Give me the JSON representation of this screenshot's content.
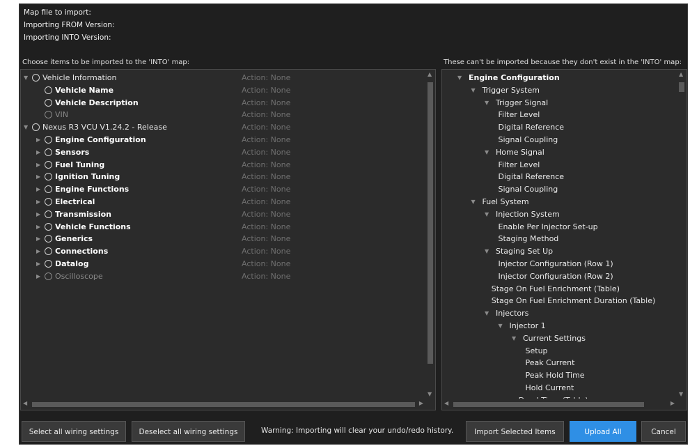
{
  "header": {
    "map_file_label": "Map file to import:",
    "from_label": "Importing FROM Version:",
    "into_label": "Importing INTO Version:"
  },
  "left_panel": {
    "caption": "Choose items to be imported to the 'INTO' map:",
    "items": [
      {
        "label": "Vehicle Information",
        "action": "Action: None",
        "level": 0,
        "arrow": "down",
        "style": "normal"
      },
      {
        "label": "Vehicle Name",
        "action": "Action: None",
        "level": 1,
        "arrow": "none",
        "style": "bold"
      },
      {
        "label": "Vehicle Description",
        "action": "Action: None",
        "level": 1,
        "arrow": "none",
        "style": "bold"
      },
      {
        "label": "VIN",
        "action": "Action: None",
        "level": 1,
        "arrow": "none",
        "style": "dim"
      },
      {
        "label": "Nexus R3 VCU V1.24.2 - Release",
        "action": "Action: None",
        "level": 0,
        "arrow": "down",
        "style": "normal"
      },
      {
        "label": "Engine Configuration",
        "action": "Action: None",
        "level": 1,
        "arrow": "right",
        "style": "bold"
      },
      {
        "label": "Sensors",
        "action": "Action: None",
        "level": 1,
        "arrow": "right",
        "style": "bold"
      },
      {
        "label": "Fuel Tuning",
        "action": "Action: None",
        "level": 1,
        "arrow": "right",
        "style": "bold"
      },
      {
        "label": "Ignition Tuning",
        "action": "Action: None",
        "level": 1,
        "arrow": "right",
        "style": "bold"
      },
      {
        "label": "Engine Functions",
        "action": "Action: None",
        "level": 1,
        "arrow": "right",
        "style": "bold"
      },
      {
        "label": "Electrical",
        "action": "Action: None",
        "level": 1,
        "arrow": "right",
        "style": "bold"
      },
      {
        "label": "Transmission",
        "action": "Action: None",
        "level": 1,
        "arrow": "right",
        "style": "bold"
      },
      {
        "label": "Vehicle Functions",
        "action": "Action: None",
        "level": 1,
        "arrow": "right",
        "style": "bold"
      },
      {
        "label": "Generics",
        "action": "Action: None",
        "level": 1,
        "arrow": "right",
        "style": "bold"
      },
      {
        "label": "Connections",
        "action": "Action: None",
        "level": 1,
        "arrow": "right",
        "style": "bold"
      },
      {
        "label": "Datalog",
        "action": "Action: None",
        "level": 1,
        "arrow": "right",
        "style": "bold"
      },
      {
        "label": "Oscilloscope",
        "action": "Action: None",
        "level": 1,
        "arrow": "right",
        "style": "dim"
      }
    ]
  },
  "right_panel": {
    "caption": "These can't be imported because they don't exist in the 'INTO' map:",
    "items": [
      {
        "label": "Engine Configuration",
        "level": 0,
        "arrow": "down",
        "style": "bold"
      },
      {
        "label": "Trigger System",
        "level": 1,
        "arrow": "down",
        "style": "normal"
      },
      {
        "label": "Trigger Signal",
        "level": 2,
        "arrow": "down",
        "style": "normal"
      },
      {
        "label": "Filter Level",
        "level": 3,
        "arrow": "none",
        "style": "normal"
      },
      {
        "label": "Digital Reference",
        "level": 3,
        "arrow": "none",
        "style": "normal"
      },
      {
        "label": "Signal Coupling",
        "level": 3,
        "arrow": "none",
        "style": "normal"
      },
      {
        "label": "Home Signal",
        "level": 2,
        "arrow": "down",
        "style": "normal"
      },
      {
        "label": "Filter Level",
        "level": 3,
        "arrow": "none",
        "style": "normal"
      },
      {
        "label": "Digital Reference",
        "level": 3,
        "arrow": "none",
        "style": "normal"
      },
      {
        "label": "Signal Coupling",
        "level": 3,
        "arrow": "none",
        "style": "normal"
      },
      {
        "label": "Fuel System",
        "level": 1,
        "arrow": "down",
        "style": "normal"
      },
      {
        "label": "Injection System",
        "level": 2,
        "arrow": "down",
        "style": "normal"
      },
      {
        "label": "Enable Per Injector Set-up",
        "level": 3,
        "arrow": "none",
        "style": "normal"
      },
      {
        "label": "Staging Method",
        "level": 3,
        "arrow": "none",
        "style": "normal"
      },
      {
        "label": "Staging Set Up",
        "level": 2,
        "arrow": "down",
        "style": "normal"
      },
      {
        "label": "Injector Configuration (Row 1)",
        "level": 3,
        "arrow": "none",
        "style": "normal"
      },
      {
        "label": "Injector Configuration (Row 2)",
        "level": 3,
        "arrow": "none",
        "style": "normal"
      },
      {
        "label": "Stage On Fuel Enrichment (Table)",
        "level": 2.5,
        "arrow": "none",
        "style": "normal"
      },
      {
        "label": "Stage On Fuel Enrichment Duration (Table)",
        "level": 2.5,
        "arrow": "none",
        "style": "normal"
      },
      {
        "label": "Injectors",
        "level": 2,
        "arrow": "down",
        "style": "normal"
      },
      {
        "label": "Injector 1",
        "level": 3,
        "arrow": "down",
        "style": "normal"
      },
      {
        "label": "Current Settings",
        "level": 4,
        "arrow": "down",
        "style": "normal"
      },
      {
        "label": "Setup",
        "level": 5,
        "arrow": "none",
        "style": "normal"
      },
      {
        "label": "Peak Current",
        "level": 5,
        "arrow": "none",
        "style": "normal"
      },
      {
        "label": "Peak Hold Time",
        "level": 5,
        "arrow": "none",
        "style": "normal"
      },
      {
        "label": "Hold Current",
        "level": 5,
        "arrow": "none",
        "style": "normal"
      },
      {
        "label": "Dead Time (Table)",
        "level": 4.5,
        "arrow": "none",
        "style": "normal"
      }
    ]
  },
  "footer": {
    "select_all_label": "Select all wiring settings",
    "deselect_all_label": "Deselect all wiring settings",
    "warning_text": "Warning: Importing will clear your undo/redo history.",
    "import_selected_label": "Import Selected Items",
    "upload_all_label": "Upload All",
    "cancel_label": "Cancel"
  },
  "colors": {
    "background": "#1f1f1f",
    "panel": "#2b2b2b",
    "accent": "#2f8fe5",
    "action_text": "#6f6f6f"
  }
}
